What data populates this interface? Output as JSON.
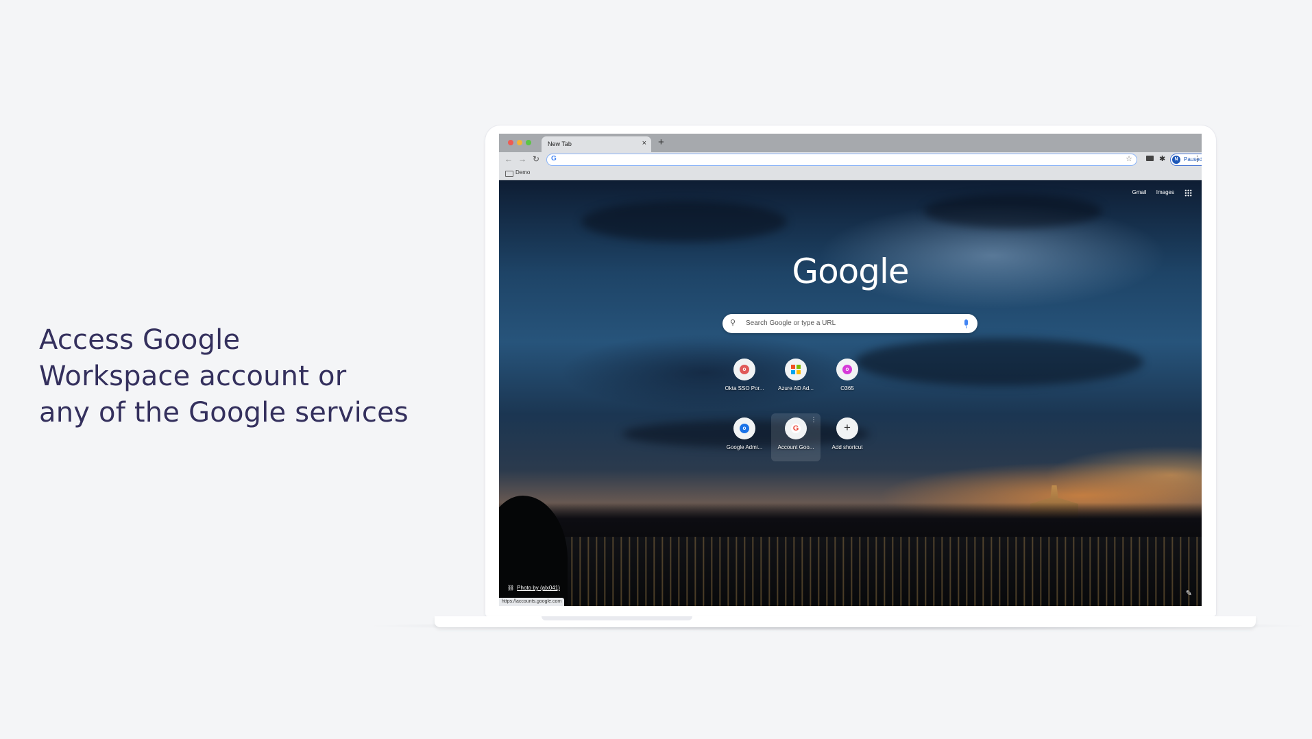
{
  "headline": {
    "lines": [
      "Access Google",
      "Workspace account or",
      "any of the Google services"
    ]
  },
  "browser": {
    "tab_title": "New Tab",
    "tab_close": "×",
    "new_tab": "+",
    "nav": {
      "back": "←",
      "forward": "→",
      "reload": "↻"
    },
    "omnibox_favicon": "G",
    "omnibox_star": "☆",
    "extensions_icon": "✱",
    "profile": {
      "initial": "N",
      "label": "Paused"
    },
    "menu": "⋮",
    "bookmark": "Demo"
  },
  "ntp": {
    "top_links": [
      "Gmail",
      "Images"
    ],
    "logo": "Google",
    "search": {
      "icon": "⚲",
      "placeholder": "Search Google or type a URL"
    },
    "shortcuts": [
      {
        "label": "Okta SSO Por...",
        "icon": "o",
        "color": "#e05a5a"
      },
      {
        "label": "Azure AD Ad...",
        "icon": "microsoft-icon",
        "color": "#f25022"
      },
      {
        "label": "O365",
        "icon": "o",
        "color": "#d63ad8"
      },
      {
        "label": "Google Admi...",
        "icon": "o",
        "color": "#1a73e8"
      },
      {
        "label": "Account Goo...",
        "icon": "G",
        "color": "#ea4335"
      },
      {
        "label": "Add shortcut",
        "icon": "+",
        "color": "#333333"
      }
    ],
    "shortcut_more": "⋮",
    "photo_credit": "Photo by (alx041)",
    "photo_link_icon": "⛓",
    "status_url": "https://accounts.google.com",
    "edit_icon": "✎"
  },
  "colors": {
    "headline": "#34305d",
    "page_bg": "#f4f5f7",
    "accent_blue": "#1a73e8"
  }
}
